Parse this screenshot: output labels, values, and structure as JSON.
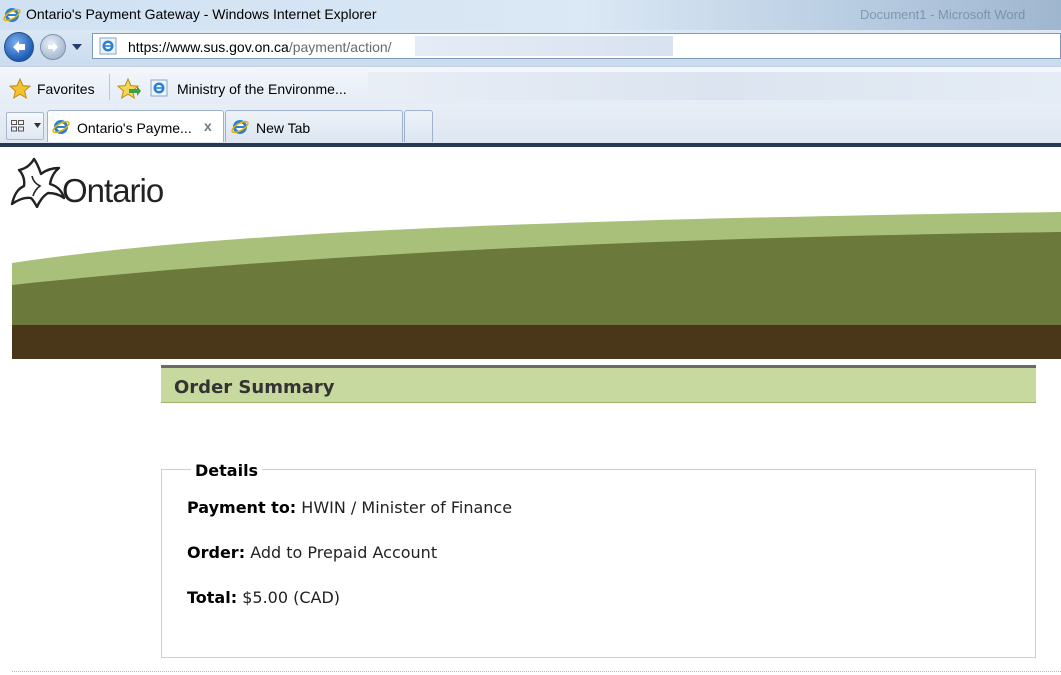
{
  "window": {
    "title": "Ontario's Payment Gateway - Windows Internet Explorer",
    "ghost_title": "Document1 - Microsoft Word"
  },
  "address_bar": {
    "url_host": "https://www.sus.gov.on.ca",
    "url_path": "/payment/action/"
  },
  "favorites_bar": {
    "favorites_label": "Favorites",
    "items": [
      {
        "label": "Ministry of the Environme...",
        "icon": "ie-icon"
      }
    ]
  },
  "tabs": [
    {
      "label": "Ontario's Payme...",
      "active": true,
      "icon": "ie-icon"
    },
    {
      "label": "New Tab",
      "active": false,
      "icon": "ie-icon"
    }
  ],
  "page": {
    "logo_text": "Ontario",
    "section_title": "Order Summary",
    "details": {
      "legend": "Details",
      "rows": [
        {
          "label": "Payment to:",
          "value": "HWIN / Minister of Finance"
        },
        {
          "label": "Order:",
          "value": "Add to Prepaid Account"
        },
        {
          "label": "Total:",
          "value": "$5.00 (CAD)"
        }
      ]
    }
  },
  "colors": {
    "header_green": "#c7d99e",
    "hill_light": "#a9c07a",
    "hill_dark": "#6b7a3a",
    "soil": "#4a3719"
  }
}
